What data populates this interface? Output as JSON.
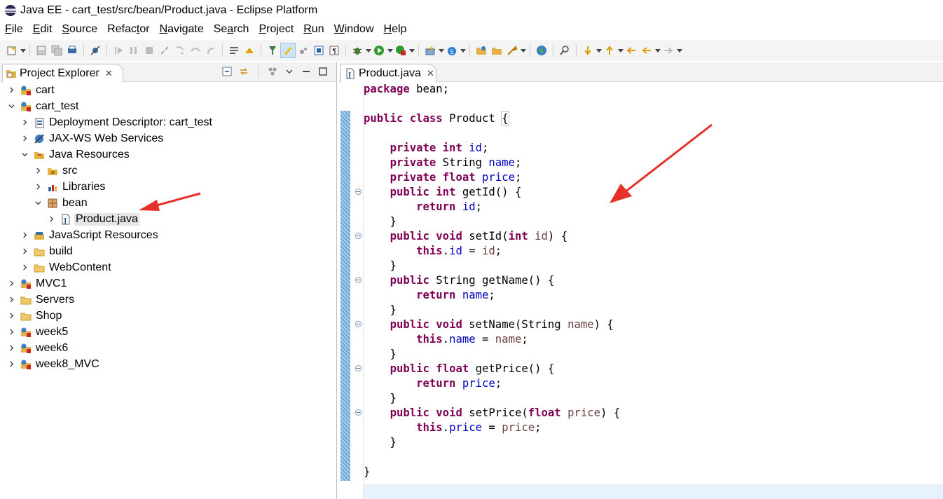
{
  "window": {
    "title": "Java EE - cart_test/src/bean/Product.java - Eclipse Platform",
    "logo_icon": "eclipse-logo-icon"
  },
  "menu": [
    {
      "mnemonic": "F",
      "rest": "ile"
    },
    {
      "mnemonic": "E",
      "rest": "dit"
    },
    {
      "mnemonic": "S",
      "rest": "ource"
    },
    {
      "pre": "Refac",
      "mnemonic": "t",
      "rest": "or"
    },
    {
      "mnemonic": "N",
      "rest": "avigate"
    },
    {
      "pre": "Se",
      "mnemonic": "a",
      "rest": "rch"
    },
    {
      "mnemonic": "P",
      "rest": "roject"
    },
    {
      "mnemonic": "R",
      "rest": "un"
    },
    {
      "mnemonic": "W",
      "rest": "indow"
    },
    {
      "mnemonic": "H",
      "rest": "elp"
    }
  ],
  "project_explorer": {
    "tab_label": "Project Explorer",
    "close_glyph": "✕",
    "tree": [
      {
        "label": "cart",
        "expanded": false,
        "icon": "dynamic-web-project-icon"
      },
      {
        "label": "cart_test",
        "expanded": true,
        "icon": "dynamic-web-project-icon"
      },
      {
        "label": "Deployment Descriptor: cart_test",
        "expanded": false,
        "icon": "deployment-descriptor-icon"
      },
      {
        "label": "JAX-WS Web Services",
        "expanded": false,
        "icon": "web-services-icon"
      },
      {
        "label": "Java Resources",
        "expanded": true,
        "icon": "java-resources-icon"
      },
      {
        "label": "src",
        "expanded": false,
        "icon": "source-folder-icon"
      },
      {
        "label": "Libraries",
        "expanded": false,
        "icon": "libraries-icon"
      },
      {
        "label": "bean",
        "expanded": true,
        "icon": "package-icon"
      },
      {
        "label": "Product.java",
        "expanded": false,
        "icon": "java-file-icon",
        "selected": true
      },
      {
        "label": "JavaScript Resources",
        "expanded": false,
        "icon": "javascript-resources-icon"
      },
      {
        "label": "build",
        "expanded": false,
        "icon": "folder-icon"
      },
      {
        "label": "WebContent",
        "expanded": false,
        "icon": "folder-icon"
      },
      {
        "label": "MVC1",
        "expanded": false,
        "icon": "dynamic-web-project-icon"
      },
      {
        "label": "Servers",
        "expanded": false,
        "icon": "folder-icon"
      },
      {
        "label": "Shop",
        "expanded": false,
        "icon": "folder-icon"
      },
      {
        "label": "week5",
        "expanded": false,
        "icon": "dynamic-web-project-icon"
      },
      {
        "label": "week6",
        "expanded": false,
        "icon": "dynamic-web-project-icon"
      },
      {
        "label": "week8_MVC",
        "expanded": false,
        "icon": "dynamic-web-project-icon"
      }
    ]
  },
  "editor": {
    "tab_label": "Product.java",
    "close_glyph": "✕",
    "code": [
      [
        {
          "t": "package",
          "c": "kw"
        },
        {
          "t": " bean;"
        }
      ],
      [],
      [
        {
          "t": "public",
          "c": "kw"
        },
        {
          "t": " "
        },
        {
          "t": "class",
          "c": "kw"
        },
        {
          "t": " Product "
        },
        {
          "t": "{",
          "c": "br-box"
        }
      ],
      [],
      [
        {
          "t": "    "
        },
        {
          "t": "private",
          "c": "kw"
        },
        {
          "t": " "
        },
        {
          "t": "int",
          "c": "kw"
        },
        {
          "t": " "
        },
        {
          "t": "id",
          "c": "fld"
        },
        {
          "t": ";"
        }
      ],
      [
        {
          "t": "    "
        },
        {
          "t": "private",
          "c": "kw"
        },
        {
          "t": " String "
        },
        {
          "t": "name",
          "c": "fld"
        },
        {
          "t": ";"
        }
      ],
      [
        {
          "t": "    "
        },
        {
          "t": "private",
          "c": "kw"
        },
        {
          "t": " "
        },
        {
          "t": "float",
          "c": "kw"
        },
        {
          "t": " "
        },
        {
          "t": "price",
          "c": "fld"
        },
        {
          "t": ";"
        }
      ],
      [
        {
          "t": "    "
        },
        {
          "t": "public",
          "c": "kw"
        },
        {
          "t": " "
        },
        {
          "t": "int",
          "c": "kw"
        },
        {
          "t": " getId() {"
        }
      ],
      [
        {
          "t": "        "
        },
        {
          "t": "return",
          "c": "kw"
        },
        {
          "t": " "
        },
        {
          "t": "id",
          "c": "fld"
        },
        {
          "t": ";"
        }
      ],
      [
        {
          "t": "    }"
        }
      ],
      [
        {
          "t": "    "
        },
        {
          "t": "public",
          "c": "kw"
        },
        {
          "t": " "
        },
        {
          "t": "void",
          "c": "kw"
        },
        {
          "t": " setId("
        },
        {
          "t": "int",
          "c": "kw"
        },
        {
          "t": " "
        },
        {
          "t": "id",
          "c": "par"
        },
        {
          "t": ") {"
        }
      ],
      [
        {
          "t": "        "
        },
        {
          "t": "this",
          "c": "kw"
        },
        {
          "t": "."
        },
        {
          "t": "id",
          "c": "fld"
        },
        {
          "t": " = "
        },
        {
          "t": "id",
          "c": "par"
        },
        {
          "t": ";"
        }
      ],
      [
        {
          "t": "    }"
        }
      ],
      [
        {
          "t": "    "
        },
        {
          "t": "public",
          "c": "kw"
        },
        {
          "t": " String getName() {"
        }
      ],
      [
        {
          "t": "        "
        },
        {
          "t": "return",
          "c": "kw"
        },
        {
          "t": " "
        },
        {
          "t": "name",
          "c": "fld"
        },
        {
          "t": ";"
        }
      ],
      [
        {
          "t": "    }"
        }
      ],
      [
        {
          "t": "    "
        },
        {
          "t": "public",
          "c": "kw"
        },
        {
          "t": " "
        },
        {
          "t": "void",
          "c": "kw"
        },
        {
          "t": " setName(String "
        },
        {
          "t": "name",
          "c": "par"
        },
        {
          "t": ") {"
        }
      ],
      [
        {
          "t": "        "
        },
        {
          "t": "this",
          "c": "kw"
        },
        {
          "t": "."
        },
        {
          "t": "name",
          "c": "fld"
        },
        {
          "t": " = "
        },
        {
          "t": "name",
          "c": "par"
        },
        {
          "t": ";"
        }
      ],
      [
        {
          "t": "    }"
        }
      ],
      [
        {
          "t": "    "
        },
        {
          "t": "public",
          "c": "kw"
        },
        {
          "t": " "
        },
        {
          "t": "float",
          "c": "kw"
        },
        {
          "t": " getPrice() {"
        }
      ],
      [
        {
          "t": "        "
        },
        {
          "t": "return",
          "c": "kw"
        },
        {
          "t": " "
        },
        {
          "t": "price",
          "c": "fld"
        },
        {
          "t": ";"
        }
      ],
      [
        {
          "t": "    }"
        }
      ],
      [
        {
          "t": "    "
        },
        {
          "t": "public",
          "c": "kw"
        },
        {
          "t": " "
        },
        {
          "t": "void",
          "c": "kw"
        },
        {
          "t": " setPrice("
        },
        {
          "t": "float",
          "c": "kw"
        },
        {
          "t": " "
        },
        {
          "t": "price",
          "c": "par"
        },
        {
          "t": ") {"
        }
      ],
      [
        {
          "t": "        "
        },
        {
          "t": "this",
          "c": "kw"
        },
        {
          "t": "."
        },
        {
          "t": "price",
          "c": "fld"
        },
        {
          "t": " = "
        },
        {
          "t": "price",
          "c": "par"
        },
        {
          "t": ";"
        }
      ],
      [
        {
          "t": "    }"
        }
      ],
      [],
      [
        {
          "t": "}"
        }
      ]
    ],
    "fold_lines": [
      8,
      11,
      14,
      17,
      20,
      23
    ]
  },
  "colors": {
    "keyword": "#7f0055",
    "field": "#0000c0",
    "parameter": "#6a3e3e",
    "annotation_arrow": "#e8302b",
    "current_line": "#e8f2fe"
  }
}
